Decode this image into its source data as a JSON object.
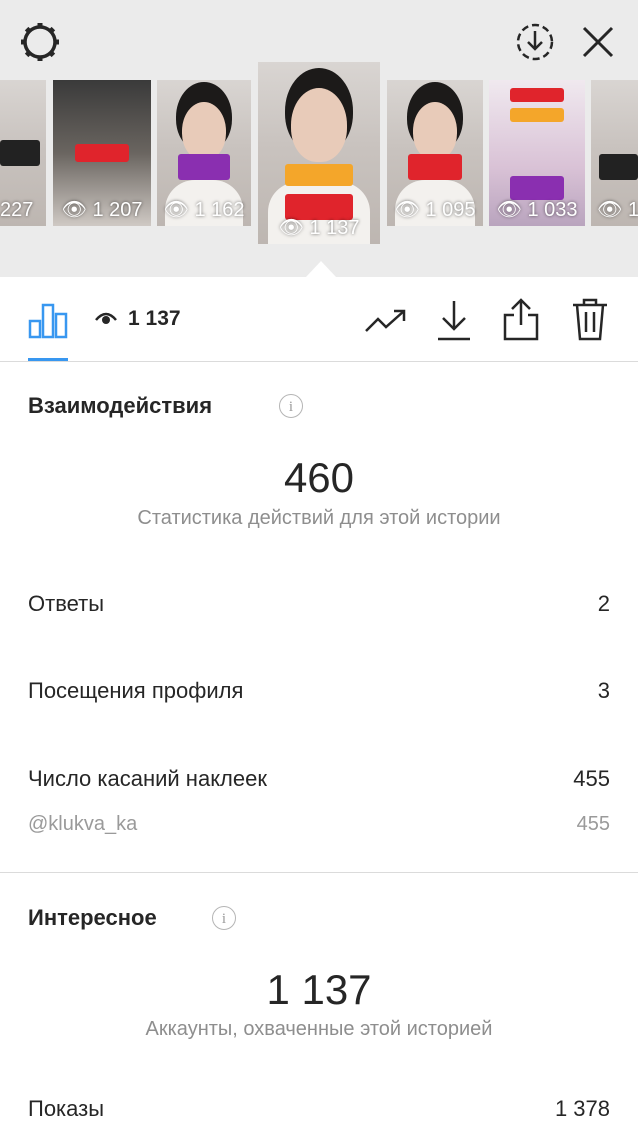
{
  "header": {
    "settings_icon": "gear-icon",
    "download_icon": "download-circle-icon",
    "close_icon": "close-icon"
  },
  "stories": [
    {
      "views": "227"
    },
    {
      "views": "1 207"
    },
    {
      "views": "1 162"
    },
    {
      "views": "1 137"
    },
    {
      "views": "1 095"
    },
    {
      "views": "1 033"
    },
    {
      "views": "1"
    }
  ],
  "toolbar": {
    "views": "1 137",
    "icons": [
      "bar-chart-icon",
      "eye-icon",
      "trend-icon",
      "download-icon",
      "share-icon",
      "trash-icon"
    ]
  },
  "interactions": {
    "title": "Взаимодействия",
    "total": "460",
    "caption": "Статистика действий для этой истории",
    "rows": [
      {
        "label": "Ответы",
        "value": "2"
      },
      {
        "label": "Посещения профиля",
        "value": "3"
      },
      {
        "label": "Число касаний наклеек",
        "value": "455"
      }
    ],
    "sticker": {
      "label": "@klukva_ka",
      "value": "455"
    }
  },
  "discovery": {
    "title": "Интересное",
    "total": "1 137",
    "caption": "Аккаунты, охваченные этой историей",
    "rows": [
      {
        "label": "Показы",
        "value": "1 378"
      }
    ]
  },
  "colors": {
    "accent": "#3897f0",
    "text": "#262626",
    "muted": "#8e8e8e",
    "header_bg": "#ebebeb"
  }
}
